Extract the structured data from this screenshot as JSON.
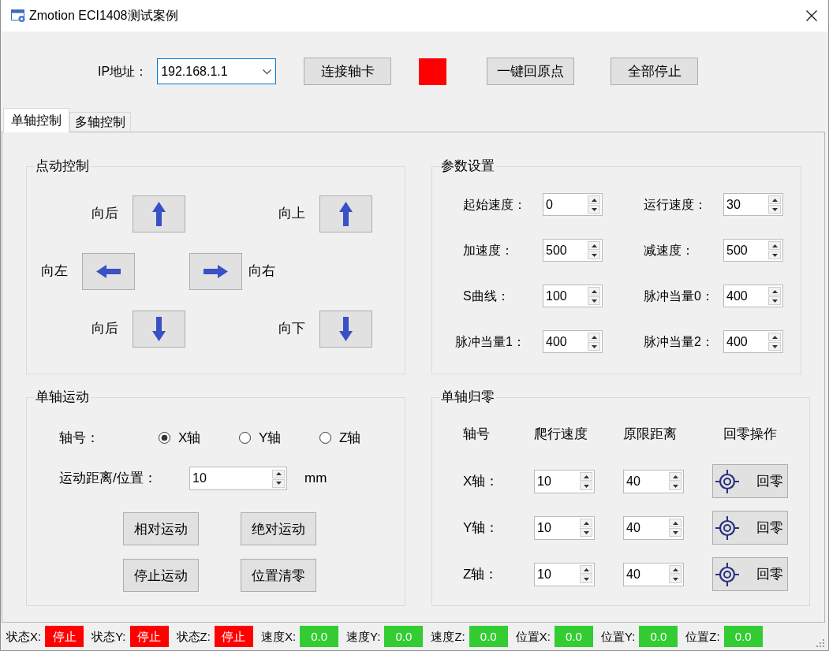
{
  "window": {
    "title": "Zmotion ECI1408测试案例"
  },
  "toolbar": {
    "ip_label": "IP地址：",
    "ip_address": "192.168.1.1",
    "connect_button": "连接轴卡",
    "connected": false,
    "home_all_button": "一键回原点",
    "stop_all_button": "全部停止"
  },
  "tabs": [
    {
      "label": "单轴控制",
      "selected": true
    },
    {
      "label": "多轴控制",
      "selected": false
    }
  ],
  "jog_control": {
    "title": "点动控制",
    "rows": [
      {
        "items": [
          {
            "label": "向后",
            "kind": "up"
          },
          {
            "label": "向上",
            "kind": "up"
          }
        ]
      },
      {
        "items": [
          {
            "label": "向左",
            "kind": "left"
          },
          {
            "label": "向右",
            "kind": "right"
          }
        ]
      },
      {
        "items": [
          {
            "label": "向后",
            "kind": "down"
          },
          {
            "label": "向下",
            "kind": "down"
          }
        ]
      }
    ]
  },
  "parameters": {
    "title": "参数设置",
    "fields": [
      {
        "label": "起始速度：",
        "value": "0"
      },
      {
        "label": "运行速度：",
        "value": "30"
      },
      {
        "label": "加速度：",
        "value": "500"
      },
      {
        "label": "减速度：",
        "value": "500"
      },
      {
        "label": "S曲线：",
        "value": "100"
      },
      {
        "label": "脉冲当量0：",
        "value": "400"
      },
      {
        "label": "脉冲当量1：",
        "value": "400"
      },
      {
        "label": "脉冲当量2：",
        "value": "400"
      }
    ]
  },
  "single_axis_motion": {
    "title": "单轴运动",
    "axis_label": "轴号：",
    "axes": [
      {
        "label": "X轴",
        "selected": true
      },
      {
        "label": "Y轴",
        "selected": false
      },
      {
        "label": "Z轴",
        "selected": false
      }
    ],
    "distance_label": "运动距离/位置：",
    "distance_value": "10",
    "unit": "mm",
    "buttons": [
      "相对运动",
      "绝对运动",
      "停止运动",
      "位置清零"
    ]
  },
  "single_axis_homing": {
    "title": "单轴归零",
    "columns": [
      "轴号",
      "爬行速度",
      "原限距离",
      "回零操作"
    ],
    "rows": [
      {
        "axis": "X轴：",
        "creep_speed": "10",
        "limit_distance": "40",
        "button": "回零"
      },
      {
        "axis": "Y轴：",
        "creep_speed": "10",
        "limit_distance": "40",
        "button": "回零"
      },
      {
        "axis": "Z轴：",
        "creep_speed": "10",
        "limit_distance": "40",
        "button": "回零"
      }
    ]
  },
  "status_bar": {
    "items": [
      {
        "label": "状态X:",
        "value": "停止",
        "color": "#ff0000"
      },
      {
        "label": "状态Y:",
        "value": "停止",
        "color": "#ff0000"
      },
      {
        "label": "状态Z:",
        "value": "停止",
        "color": "#ff0000"
      },
      {
        "label": "速度X:",
        "value": "0.0",
        "color": "#33cc33"
      },
      {
        "label": "速度Y:",
        "value": "0.0",
        "color": "#33cc33"
      },
      {
        "label": "速度Z:",
        "value": "0.0",
        "color": "#33cc33"
      },
      {
        "label": "位置X:",
        "value": "0.0",
        "color": "#33cc33"
      },
      {
        "label": "位置Y:",
        "value": "0.0",
        "color": "#33cc33"
      },
      {
        "label": "位置Z:",
        "value": "0.0",
        "color": "#33cc33"
      }
    ]
  }
}
